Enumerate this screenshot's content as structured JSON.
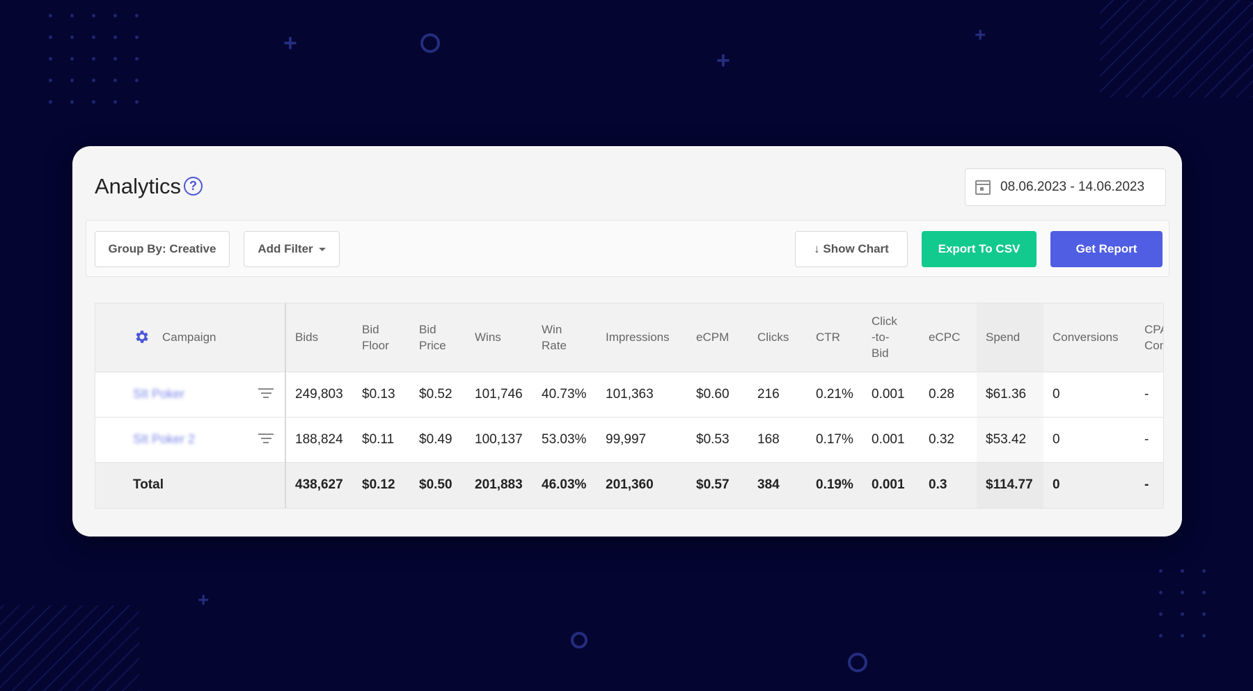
{
  "header": {
    "title": "Analytics",
    "help_icon": "?",
    "date_range": "08.06.2023 - 14.06.2023"
  },
  "toolbar": {
    "group_by_label": "Group By: Creative",
    "add_filter_label": "Add Filter",
    "show_chart_label": "↓ Show Chart",
    "export_csv_label": "Export To CSV",
    "get_report_label": "Get Report"
  },
  "colors": {
    "export_button": "#12c98e",
    "report_button": "#4f5ee3",
    "accent": "#4a56d8",
    "background": "#040531"
  },
  "table": {
    "columns": [
      "Campaign",
      "Bids",
      "Bid Floor",
      "Bid Price",
      "Wins",
      "Win Rate",
      "Impressions",
      "eCPM",
      "Clicks",
      "CTR",
      "Click-to-Bid",
      "eCPC",
      "Spend",
      "Conversions",
      "CPA Con"
    ],
    "rows": [
      {
        "campaign": "SIt Poker",
        "values": [
          "249,803",
          "$0.13",
          "$0.52",
          "101,746",
          "40.73%",
          "101,363",
          "$0.60",
          "216",
          "0.21%",
          "0.001",
          "0.28",
          "$61.36",
          "0",
          "-"
        ]
      },
      {
        "campaign": "SIt Poker 2",
        "values": [
          "188,824",
          "$0.11",
          "$0.49",
          "100,137",
          "53.03%",
          "99,997",
          "$0.53",
          "168",
          "0.17%",
          "0.001",
          "0.32",
          "$53.42",
          "0",
          "-"
        ]
      }
    ],
    "total": {
      "label": "Total",
      "values": [
        "438,627",
        "$0.12",
        "$0.50",
        "201,883",
        "46.03%",
        "201,360",
        "$0.57",
        "384",
        "0.19%",
        "0.001",
        "0.3",
        "$114.77",
        "0",
        "-"
      ]
    }
  }
}
